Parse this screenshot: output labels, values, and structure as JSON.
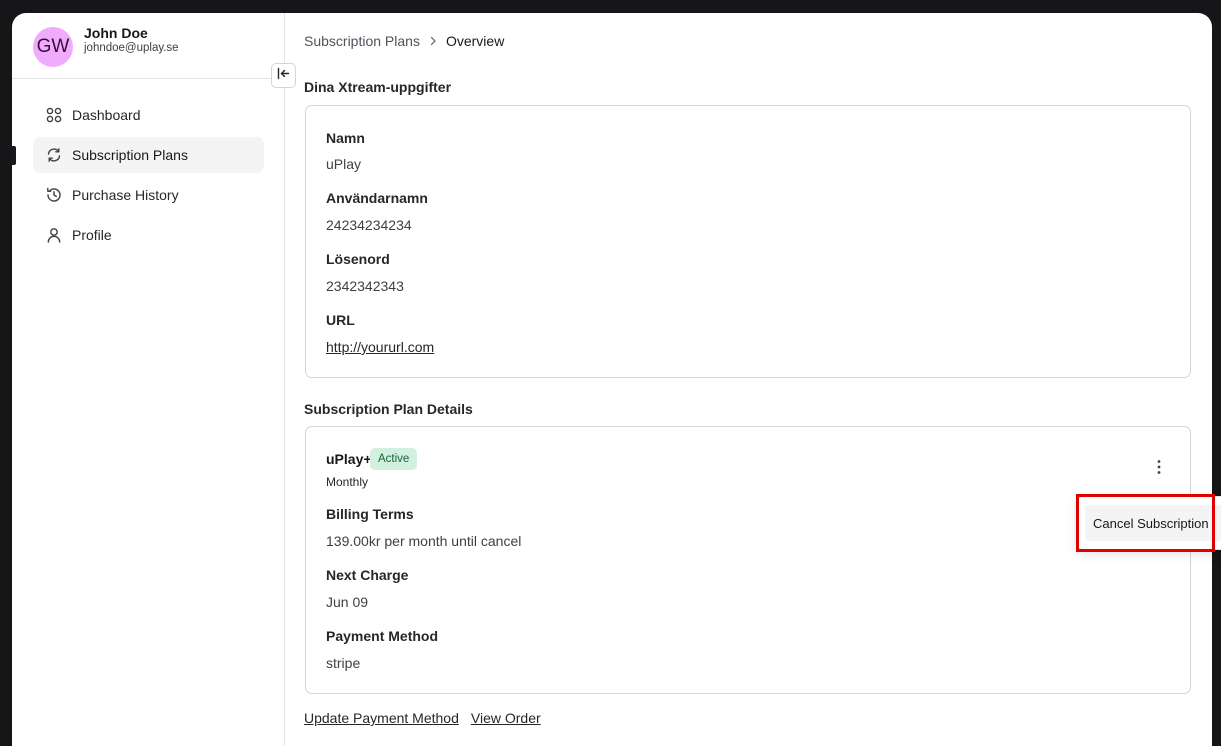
{
  "user": {
    "initials": "GW",
    "name": "John Doe",
    "email": "johndoe@uplay.se"
  },
  "sidebar": {
    "items": [
      {
        "label": "Dashboard",
        "icon": "dashboard-icon",
        "active": false
      },
      {
        "label": "Subscription Plans",
        "icon": "refresh-icon",
        "active": true
      },
      {
        "label": "Purchase History",
        "icon": "history-icon",
        "active": false
      },
      {
        "label": "Profile",
        "icon": "user-icon",
        "active": false
      }
    ]
  },
  "breadcrumb": {
    "parent": "Subscription Plans",
    "current": "Overview"
  },
  "xtream": {
    "title": "Dina Xtream-uppgifter",
    "fields": [
      {
        "label": "Namn",
        "value": "uPlay"
      },
      {
        "label": "Användarnamn",
        "value": "24234234234"
      },
      {
        "label": "Lösenord",
        "value": "2342342343"
      },
      {
        "label": "URL",
        "value": "http://yoururl.com"
      }
    ]
  },
  "plan": {
    "title": "Subscription Plan Details",
    "name": "uPlay+",
    "status": "Active",
    "period": "Monthly",
    "fields": [
      {
        "label": "Billing Terms",
        "value": "139.00kr per month until cancel"
      },
      {
        "label": "Next Charge",
        "value": "Jun 09"
      },
      {
        "label": "Payment Method",
        "value": "stripe"
      }
    ]
  },
  "actions": {
    "update_payment": "Update Payment Method",
    "view_order": "View Order"
  },
  "menu": {
    "cancel": "Cancel Subscription"
  },
  "colors": {
    "accent": "#18181b",
    "badge_bg": "#d1f0e0",
    "badge_text": "#166534",
    "highlight": "#e00000"
  }
}
